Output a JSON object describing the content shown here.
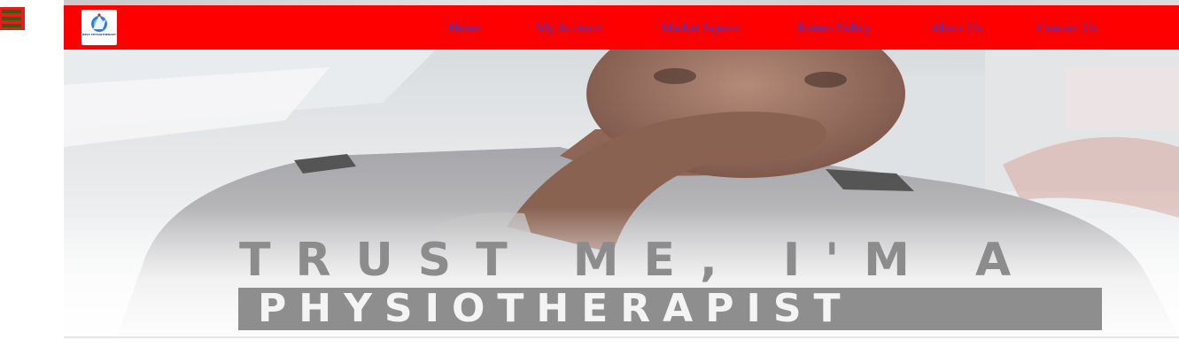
{
  "nav": {
    "items": [
      {
        "label": "Home"
      },
      {
        "label": "My Account"
      },
      {
        "label": "Market Square"
      },
      {
        "label": "Return Policy"
      },
      {
        "label": "About Us"
      },
      {
        "label": "Contact Us"
      }
    ],
    "link_color": "#3b3bd6",
    "bar_color": "#ff0000"
  },
  "logo": {
    "text": "REST PHYSIOTHERAPY",
    "icon": "physiotherapy-logo-icon"
  },
  "menu": {
    "icon": "hamburger-menu-icon"
  },
  "hero": {
    "line1": "TRUST ME, I'M A",
    "line2": "PHYSIOTHERAPIST"
  }
}
